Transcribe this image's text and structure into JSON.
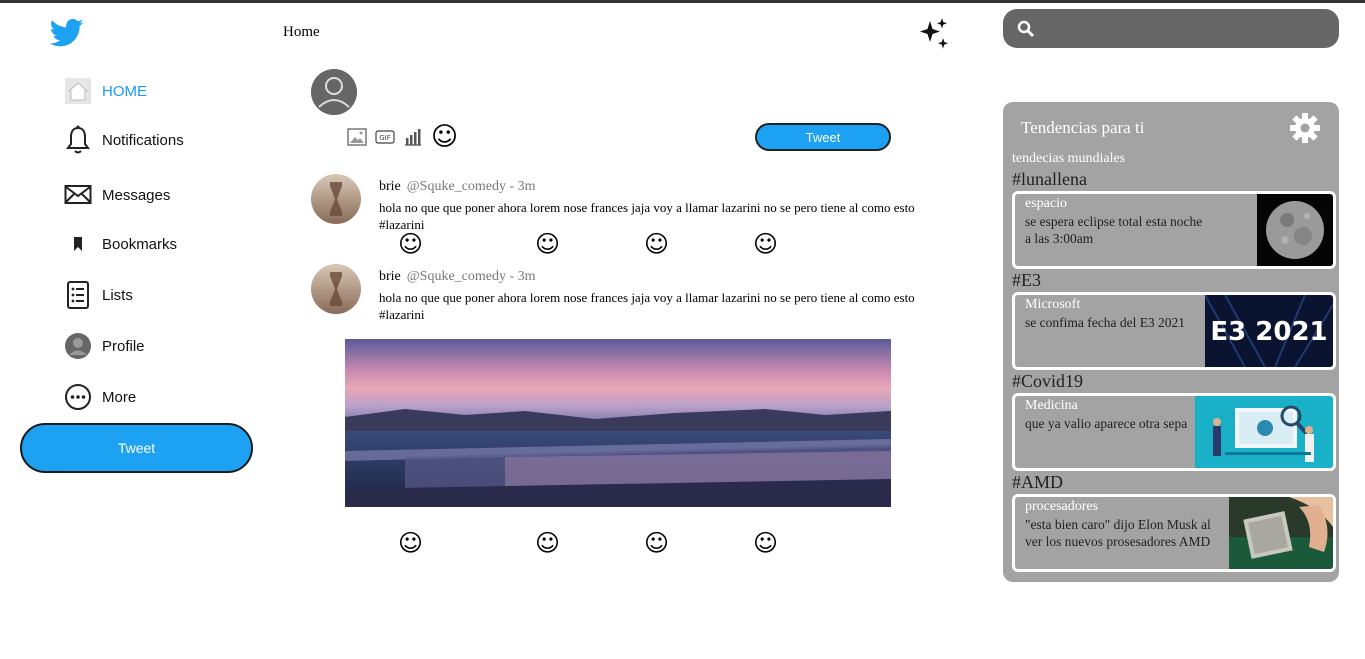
{
  "sidebar": {
    "items": [
      {
        "label": "HOME",
        "icon": "home-icon",
        "active": true
      },
      {
        "label": "Notifications",
        "icon": "bell-icon"
      },
      {
        "label": "Messages",
        "icon": "envelope-icon"
      },
      {
        "label": "Bookmarks",
        "icon": "bookmark-icon"
      },
      {
        "label": "Lists",
        "icon": "list-icon"
      },
      {
        "label": "Profile",
        "icon": "profile-icon"
      },
      {
        "label": "More",
        "icon": "more-icon"
      }
    ],
    "tweet_button": "Tweet"
  },
  "header": {
    "title": "Home"
  },
  "compose": {
    "tweet_button": "Tweet"
  },
  "tweets": [
    {
      "name": "brie",
      "handle": "@Squke_comedy - 3m",
      "text": "hola no que que poner ahora lorem nose frances jaja voy a llamar lazarini no se pero tiene al como esto #lazarini"
    },
    {
      "name": "brie",
      "handle": "@Squke_comedy - 3m",
      "text": "hola no que que poner ahora lorem nose frances jaja voy a llamar lazarini no se pero tiene al como esto #lazarini"
    }
  ],
  "search": {
    "placeholder": ""
  },
  "trends": {
    "title": "Tendencias para ti",
    "subtitle": "tendecias mundiales",
    "items": [
      {
        "tag": "#lunallena",
        "title": "espacio",
        "body": "se espera eclipse total esta noche a las 3:00am"
      },
      {
        "tag": "#E3",
        "title": "Microsoft",
        "body": "se confima fecha del E3 2021",
        "image_text": "E3 2021"
      },
      {
        "tag": "#Covid19",
        "title": "Medicina",
        "body": "que ya valio aparece otra sepa"
      },
      {
        "tag": "#AMD",
        "title": "procesadores",
        "body": "\"esta bien caro\" dijo Elon Musk al ver los nuevos prosesadores AMD"
      }
    ]
  },
  "colors": {
    "accent": "#1da1f2",
    "panel": "#a3a3a3",
    "search_bg": "#666666"
  }
}
